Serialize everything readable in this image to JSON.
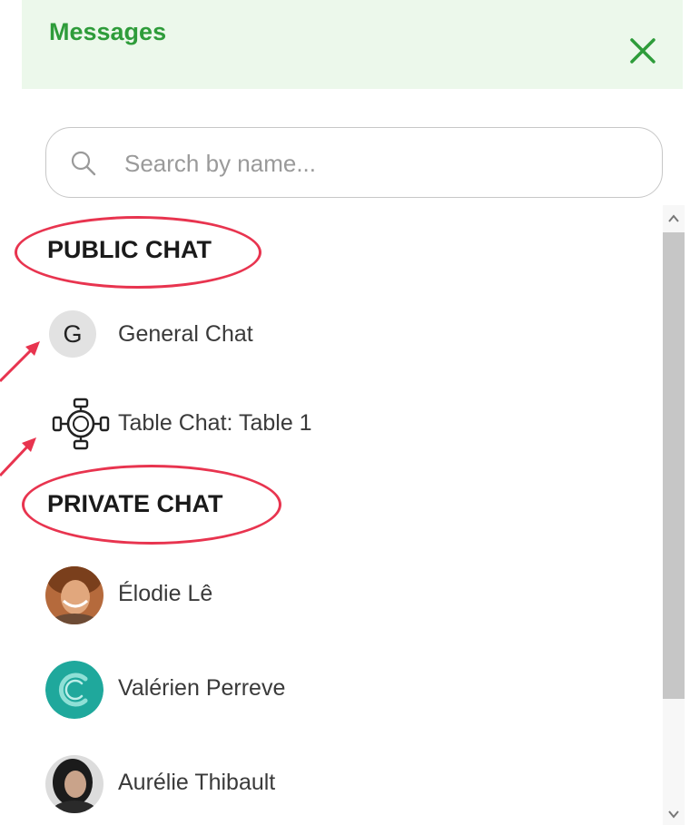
{
  "header": {
    "title": "Messages"
  },
  "search": {
    "placeholder": "Search by name..."
  },
  "public_section": {
    "title": "PUBLIC CHAT",
    "items": [
      {
        "avatar_letter": "G",
        "label": "General Chat",
        "icon": "letter-avatar"
      },
      {
        "label": "Table Chat: Table 1",
        "icon": "table-icon"
      }
    ]
  },
  "private_section": {
    "title": "PRIVATE CHAT",
    "items": [
      {
        "label": "Élodie Lê",
        "avatar": "photo-avatar"
      },
      {
        "label": "Valérien Perreve",
        "avatar": "teal-logo-avatar"
      },
      {
        "label": "Aurélie Thibault",
        "avatar": "photo-avatar"
      }
    ]
  },
  "colors": {
    "header_bg": "#ecf8eb",
    "accent_green": "#2e9c3a",
    "annotation_red": "#e8344f",
    "teal_avatar": "#1fa89c"
  }
}
